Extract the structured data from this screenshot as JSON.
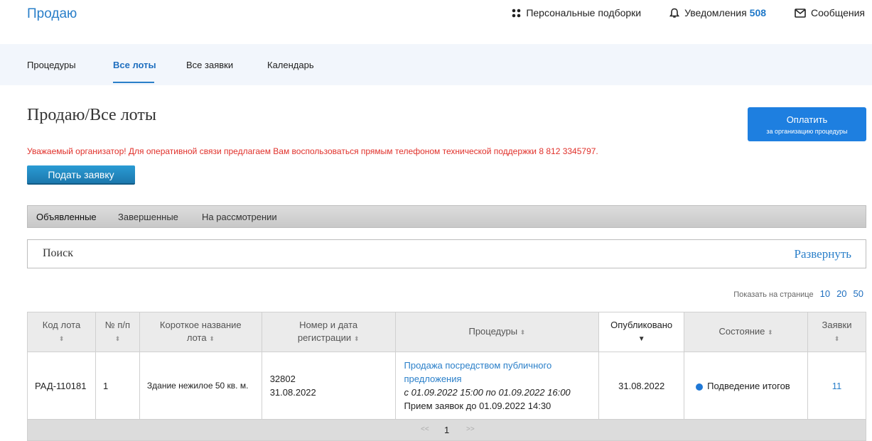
{
  "header": {
    "brand": "Продаю",
    "actions": [
      {
        "label": "Персональные подборки",
        "icon": "grid-dots-icon"
      },
      {
        "label": "Уведомления",
        "icon": "bell-icon",
        "count": "508"
      },
      {
        "label": "Сообщения",
        "icon": "envelope-icon"
      }
    ]
  },
  "nav": {
    "tabs": [
      {
        "label": "Процедуры",
        "active": false
      },
      {
        "label": "Все лоты",
        "active": true
      },
      {
        "label": "Все заявки",
        "active": false
      },
      {
        "label": "Календарь",
        "active": false
      }
    ]
  },
  "page": {
    "title": "Продаю/Все лоты",
    "pay_button_line1": "Оплатить",
    "pay_button_line2": "за организацию процедуры",
    "notice": "Уважаемый организатор! Для оперативной связи предлагаем Вам воспользоваться прямым телефоном технической поддержки 8 812 3345797.",
    "submit_button": "Подать заявку"
  },
  "filter_tabs": [
    {
      "label": "Объявленные",
      "active": true
    },
    {
      "label": "Завершенные",
      "active": false
    },
    {
      "label": "На рассмотрении",
      "active": false
    }
  ],
  "search": {
    "label": "Поиск",
    "expand": "Развернуть"
  },
  "per_page": {
    "label": "Показать на странице",
    "options": [
      "10",
      "20",
      "50"
    ]
  },
  "table": {
    "headers": {
      "code": "Код лота",
      "num": "№ п/п",
      "name_l1": "Короткое название",
      "name_l2": "лота",
      "reg_l1": "Номер и дата",
      "reg_l2": "регистрации",
      "proc": "Процедуры",
      "published": "Опубликовано",
      "state": "Состояние",
      "apps": "Заявки"
    },
    "rows": [
      {
        "code": "РАД-110181",
        "num": "1",
        "name": "Здание нежилое 50 кв. м.",
        "reg_number": "32802",
        "reg_date": "31.08.2022",
        "proc_l1": "Продажа посредством публичного",
        "proc_l2": "предложения",
        "proc_dates": "с  01.09.2022 15:00  по  01.09.2022 16:00",
        "proc_deadline": "Прием заявок до  01.09.2022 14:30",
        "published": "31.08.2022",
        "state": "Подведение итогов",
        "apps": "11"
      }
    ]
  },
  "pager": {
    "prev": "<<",
    "current": "1",
    "next": ">>"
  },
  "colors": {
    "accent": "#2a7fc9",
    "pay_button": "#1e7fe0",
    "notice_red": "#e0302a",
    "status_dot": "#1f78d6"
  }
}
